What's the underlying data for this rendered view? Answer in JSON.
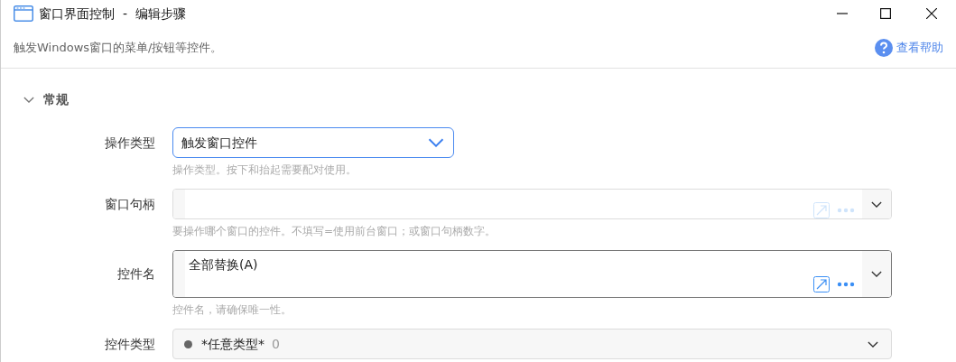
{
  "window": {
    "title": "窗口界面控制  -  编辑步骤"
  },
  "description": "触发Windows窗口的菜单/按钮等控件。",
  "help_link": "查看帮助",
  "section": {
    "title": "常规",
    "expanded": true,
    "fields": [
      {
        "kind": "dropdown",
        "label": "操作类型",
        "value": "触发窗口控件",
        "focused": true,
        "hint": "操作类型。按下和抬起需要配对使用。"
      },
      {
        "kind": "combo",
        "label": "窗口句柄",
        "multiline": false,
        "icons_enabled": false,
        "hint": "要操作哪个窗口的控件。不填写=使用前台窗口；或窗口句柄数字。"
      },
      {
        "kind": "combo",
        "label": "控件名",
        "value": "全部替换(A)",
        "multiline": true,
        "icons_enabled": true,
        "hint": "控件名，请确保唯一性。"
      },
      {
        "kind": "type",
        "label": "控件类型",
        "value": "*任意类型*",
        "count": "0",
        "color": "#666666"
      }
    ]
  }
}
